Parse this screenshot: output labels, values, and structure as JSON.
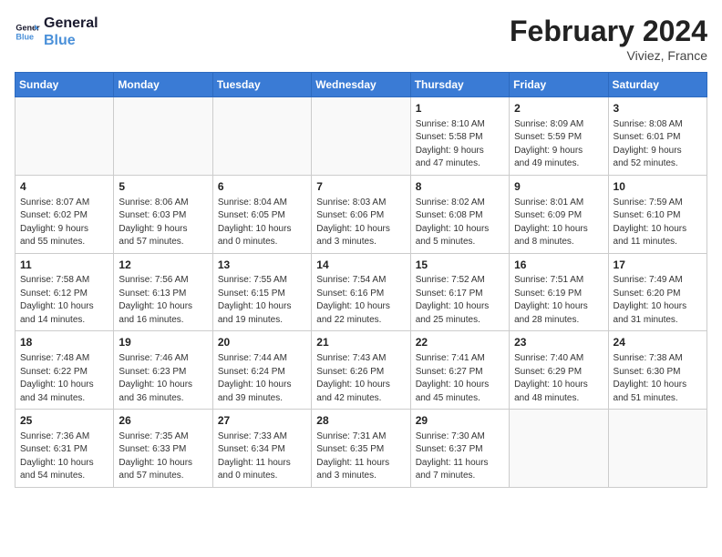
{
  "header": {
    "logo_line1": "General",
    "logo_line2": "Blue",
    "month_year": "February 2024",
    "location": "Viviez, France"
  },
  "weekdays": [
    "Sunday",
    "Monday",
    "Tuesday",
    "Wednesday",
    "Thursday",
    "Friday",
    "Saturday"
  ],
  "weeks": [
    [
      {
        "day": "",
        "info": ""
      },
      {
        "day": "",
        "info": ""
      },
      {
        "day": "",
        "info": ""
      },
      {
        "day": "",
        "info": ""
      },
      {
        "day": "1",
        "info": "Sunrise: 8:10 AM\nSunset: 5:58 PM\nDaylight: 9 hours\nand 47 minutes."
      },
      {
        "day": "2",
        "info": "Sunrise: 8:09 AM\nSunset: 5:59 PM\nDaylight: 9 hours\nand 49 minutes."
      },
      {
        "day": "3",
        "info": "Sunrise: 8:08 AM\nSunset: 6:01 PM\nDaylight: 9 hours\nand 52 minutes."
      }
    ],
    [
      {
        "day": "4",
        "info": "Sunrise: 8:07 AM\nSunset: 6:02 PM\nDaylight: 9 hours\nand 55 minutes."
      },
      {
        "day": "5",
        "info": "Sunrise: 8:06 AM\nSunset: 6:03 PM\nDaylight: 9 hours\nand 57 minutes."
      },
      {
        "day": "6",
        "info": "Sunrise: 8:04 AM\nSunset: 6:05 PM\nDaylight: 10 hours\nand 0 minutes."
      },
      {
        "day": "7",
        "info": "Sunrise: 8:03 AM\nSunset: 6:06 PM\nDaylight: 10 hours\nand 3 minutes."
      },
      {
        "day": "8",
        "info": "Sunrise: 8:02 AM\nSunset: 6:08 PM\nDaylight: 10 hours\nand 5 minutes."
      },
      {
        "day": "9",
        "info": "Sunrise: 8:01 AM\nSunset: 6:09 PM\nDaylight: 10 hours\nand 8 minutes."
      },
      {
        "day": "10",
        "info": "Sunrise: 7:59 AM\nSunset: 6:10 PM\nDaylight: 10 hours\nand 11 minutes."
      }
    ],
    [
      {
        "day": "11",
        "info": "Sunrise: 7:58 AM\nSunset: 6:12 PM\nDaylight: 10 hours\nand 14 minutes."
      },
      {
        "day": "12",
        "info": "Sunrise: 7:56 AM\nSunset: 6:13 PM\nDaylight: 10 hours\nand 16 minutes."
      },
      {
        "day": "13",
        "info": "Sunrise: 7:55 AM\nSunset: 6:15 PM\nDaylight: 10 hours\nand 19 minutes."
      },
      {
        "day": "14",
        "info": "Sunrise: 7:54 AM\nSunset: 6:16 PM\nDaylight: 10 hours\nand 22 minutes."
      },
      {
        "day": "15",
        "info": "Sunrise: 7:52 AM\nSunset: 6:17 PM\nDaylight: 10 hours\nand 25 minutes."
      },
      {
        "day": "16",
        "info": "Sunrise: 7:51 AM\nSunset: 6:19 PM\nDaylight: 10 hours\nand 28 minutes."
      },
      {
        "day": "17",
        "info": "Sunrise: 7:49 AM\nSunset: 6:20 PM\nDaylight: 10 hours\nand 31 minutes."
      }
    ],
    [
      {
        "day": "18",
        "info": "Sunrise: 7:48 AM\nSunset: 6:22 PM\nDaylight: 10 hours\nand 34 minutes."
      },
      {
        "day": "19",
        "info": "Sunrise: 7:46 AM\nSunset: 6:23 PM\nDaylight: 10 hours\nand 36 minutes."
      },
      {
        "day": "20",
        "info": "Sunrise: 7:44 AM\nSunset: 6:24 PM\nDaylight: 10 hours\nand 39 minutes."
      },
      {
        "day": "21",
        "info": "Sunrise: 7:43 AM\nSunset: 6:26 PM\nDaylight: 10 hours\nand 42 minutes."
      },
      {
        "day": "22",
        "info": "Sunrise: 7:41 AM\nSunset: 6:27 PM\nDaylight: 10 hours\nand 45 minutes."
      },
      {
        "day": "23",
        "info": "Sunrise: 7:40 AM\nSunset: 6:29 PM\nDaylight: 10 hours\nand 48 minutes."
      },
      {
        "day": "24",
        "info": "Sunrise: 7:38 AM\nSunset: 6:30 PM\nDaylight: 10 hours\nand 51 minutes."
      }
    ],
    [
      {
        "day": "25",
        "info": "Sunrise: 7:36 AM\nSunset: 6:31 PM\nDaylight: 10 hours\nand 54 minutes."
      },
      {
        "day": "26",
        "info": "Sunrise: 7:35 AM\nSunset: 6:33 PM\nDaylight: 10 hours\nand 57 minutes."
      },
      {
        "day": "27",
        "info": "Sunrise: 7:33 AM\nSunset: 6:34 PM\nDaylight: 11 hours\nand 0 minutes."
      },
      {
        "day": "28",
        "info": "Sunrise: 7:31 AM\nSunset: 6:35 PM\nDaylight: 11 hours\nand 3 minutes."
      },
      {
        "day": "29",
        "info": "Sunrise: 7:30 AM\nSunset: 6:37 PM\nDaylight: 11 hours\nand 7 minutes."
      },
      {
        "day": "",
        "info": ""
      },
      {
        "day": "",
        "info": ""
      }
    ]
  ]
}
